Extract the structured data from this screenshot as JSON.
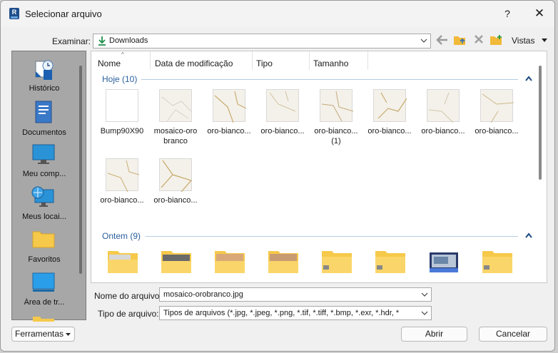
{
  "window": {
    "title": "Selecionar arquivo",
    "app_icon": "R",
    "help": "?",
    "close": "✕"
  },
  "toolbar": {
    "examinar_label": "Examinar:",
    "location": "Downloads",
    "vistas": "Vistas"
  },
  "places": [
    {
      "label": "Histórico",
      "icon": "history-icon"
    },
    {
      "label": "Documentos",
      "icon": "documents-icon"
    },
    {
      "label": "Meu comp...",
      "icon": "computer-icon"
    },
    {
      "label": "Meus locai...",
      "icon": "network-places-icon"
    },
    {
      "label": "Favoritos",
      "icon": "favorites-folder-icon"
    },
    {
      "label": "Área de tr...",
      "icon": "desktop-icon"
    }
  ],
  "columns": [
    "Nome",
    "Data de modificação",
    "Tipo",
    "Tamanho"
  ],
  "groups": [
    {
      "label": "Hoje (10)",
      "items": [
        "Bump90X90",
        "mosaico-oro branco",
        "oro-bianco...",
        "oro-bianco...",
        "oro-bianco... (1)",
        "oro-bianco...",
        "oro-bianco...",
        "oro-bianco...",
        "oro-bianco...",
        "oro-bianco..."
      ]
    },
    {
      "label": "Ontem (9)"
    }
  ],
  "form": {
    "filename_label": "Nome do arquivo:",
    "filename_value": "mosaico-orobranco.jpg",
    "filetype_label": "Tipo de arquivo:",
    "filetype_value": "Tipos de arquivos (*.jpg, *.jpeg, *.png, *.tif, *.tiff, *.bmp, *.exr, *.hdr, *"
  },
  "buttons": {
    "tools": "Ferramentas",
    "open": "Abrir",
    "cancel": "Cancelar"
  },
  "colors": {
    "accent": "#2a5f9e",
    "folder": "#f6c94a"
  }
}
